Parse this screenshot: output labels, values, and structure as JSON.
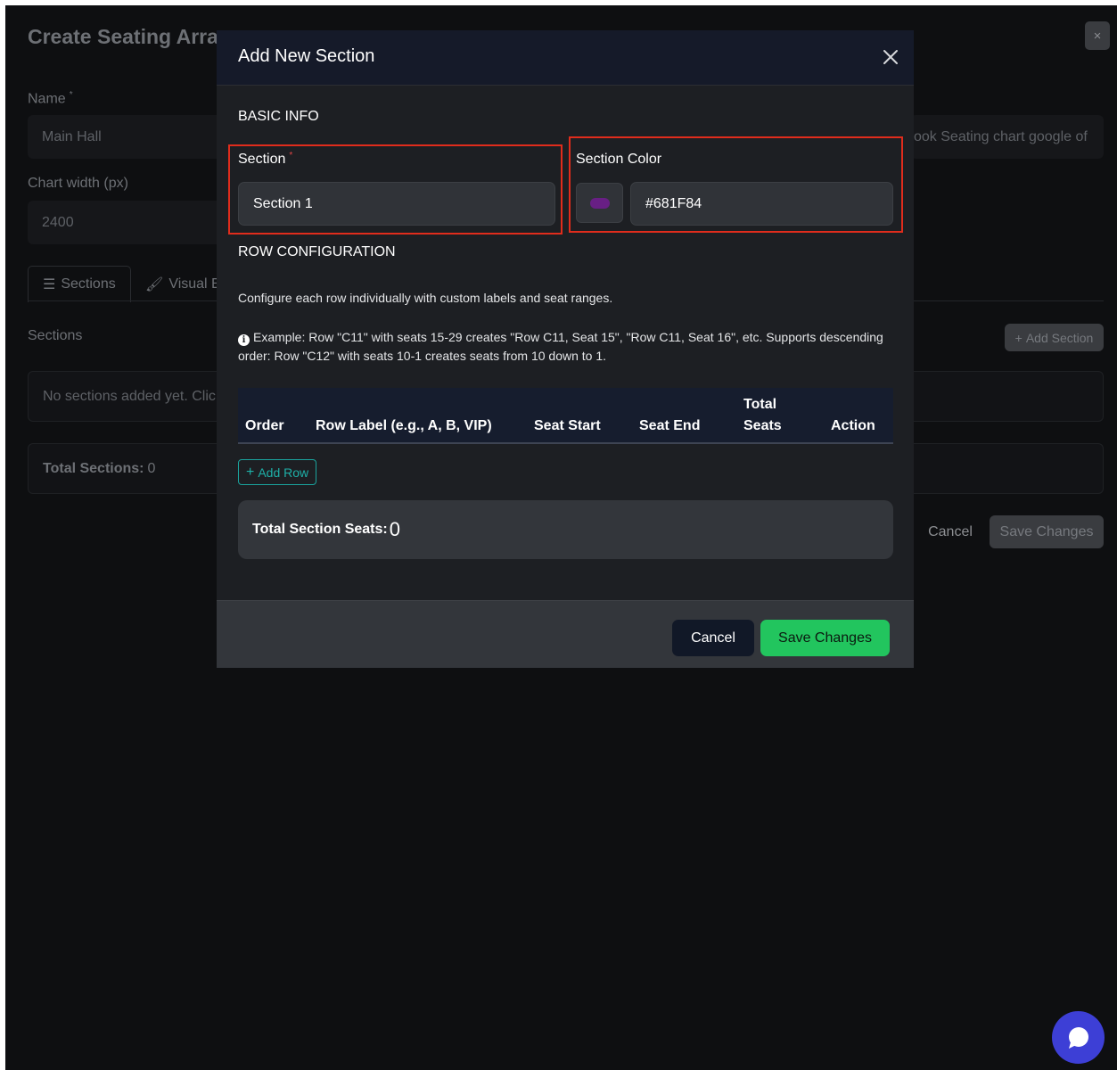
{
  "background": {
    "title": "Create Seating Arra",
    "close_label": "×",
    "name_label": "Name",
    "name_required": "*",
    "name_value": "Main Hall",
    "google_text": "ook  Seating chart google of",
    "chart_width_label": "Chart width (px)",
    "chart_width_value": "2400",
    "tabs": [
      {
        "label": "Sections",
        "icon": "list-icon"
      },
      {
        "label": "Visual Ed",
        "icon": "brush-icon"
      }
    ],
    "sections_heading": "Sections",
    "add_section_label": "Add Section",
    "empty_text": "No sections added yet. Clic",
    "total_sections_label": "Total Sections:",
    "total_sections_value": "0",
    "cancel_label": "Cancel",
    "save_label": "Save Changes"
  },
  "modal": {
    "title": "Add New Section",
    "close_icon": "close-icon",
    "basic_info_heading": "BASIC INFO",
    "section_label": "Section",
    "section_required": "*",
    "section_value": "Section 1",
    "section_color_label": "Section Color",
    "section_color_value": "#681F84",
    "row_config_heading": "ROW CONFIGURATION",
    "row_config_desc": "Configure each row individually with custom labels and seat ranges.",
    "example_text": "Example: Row \"C11\" with seats 15-29 creates \"Row C11, Seat 15\", \"Row C11, Seat 16\", etc. Supports descending order: Row \"C12\" with seats 10-1 creates seats from 10 down to 1.",
    "table_headers": {
      "order": "Order",
      "row_label": "Row Label (e.g., A, B, VIP)",
      "seat_start": "Seat Start",
      "seat_end": "Seat End",
      "total_seats_line1": "Total",
      "total_seats_line2": "Seats",
      "action": "Action"
    },
    "add_row_label": "Add Row",
    "total_section_seats_label": "Total Section Seats:",
    "total_section_seats_value": "0",
    "cancel_label": "Cancel",
    "save_label": "Save Changes"
  },
  "colors": {
    "section_color": "#681F84",
    "save_green": "#22c55e",
    "highlight_red": "#e02c1c",
    "chat_blue": "#3d3fd6"
  }
}
